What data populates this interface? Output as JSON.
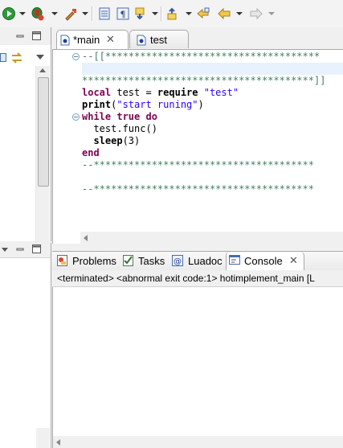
{
  "toolbar": {
    "icons": [
      "run-icon",
      "debug-icon",
      "external-tools-icon",
      "open-task-icon",
      "show-whitespace-icon",
      "next-annotation-icon",
      "prev-annotation-icon",
      "last-edit-location-icon",
      "back-icon",
      "forward-icon"
    ]
  },
  "editor": {
    "tabs": [
      {
        "label": "*main",
        "active": true,
        "close": "✕"
      },
      {
        "label": "test",
        "active": false
      }
    ],
    "lines": [
      [
        {
          "t": "--[[*************************************",
          "c": "c-cmt"
        }
      ],
      [],
      [
        {
          "t": "****************************************]]",
          "c": "c-cmt"
        }
      ],
      [
        {
          "t": "local",
          "c": "c-kw"
        },
        {
          "t": " test = ",
          "c": "c-id"
        },
        {
          "t": "require",
          "c": "c-glob"
        },
        {
          "t": " ",
          "c": "c-id"
        },
        {
          "t": "\"test\"",
          "c": "c-str"
        }
      ],
      [
        {
          "t": "print",
          "c": "c-glob"
        },
        {
          "t": "(",
          "c": "c-id"
        },
        {
          "t": "\"start runing\"",
          "c": "c-str"
        },
        {
          "t": ")",
          "c": "c-id"
        }
      ],
      [
        {
          "t": "while",
          "c": "c-kw"
        },
        {
          "t": " ",
          "c": "c-id"
        },
        {
          "t": "true",
          "c": "c-kw"
        },
        {
          "t": " ",
          "c": "c-id"
        },
        {
          "t": "do",
          "c": "c-kw"
        }
      ],
      [
        {
          "t": "  test.func()",
          "c": "c-id"
        }
      ],
      [
        {
          "t": "  ",
          "c": "c-id"
        },
        {
          "t": "sleep",
          "c": "c-glob"
        },
        {
          "t": "(3)",
          "c": "c-num"
        }
      ],
      [
        {
          "t": "end",
          "c": "c-kw"
        }
      ],
      [
        {
          "t": "--**************************************",
          "c": "c-cmt"
        }
      ],
      [],
      [
        {
          "t": "--**************************************",
          "c": "c-cmt"
        }
      ]
    ]
  },
  "console": {
    "tabs": [
      {
        "label": "Problems",
        "icon": "problems-icon"
      },
      {
        "label": "Tasks",
        "icon": "tasks-icon"
      },
      {
        "label": "Luadoc",
        "icon": "luadoc-icon"
      },
      {
        "label": "Console",
        "icon": "console-icon",
        "active": true,
        "close": "✕"
      }
    ],
    "status": "<terminated> <abnormal exit code:1> hotimplement_main [L"
  }
}
